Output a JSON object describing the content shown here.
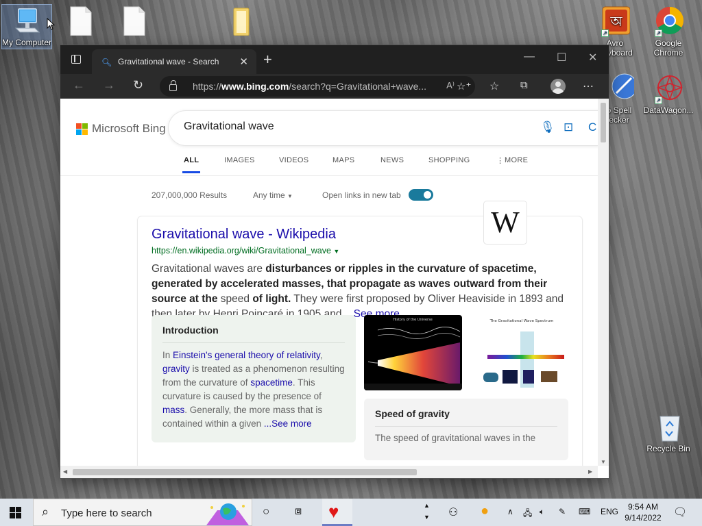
{
  "desktop": {
    "icons": [
      {
        "label": "My Computer a",
        "icon": "monitor-icon"
      },
      {
        "label": "",
        "icon": "file-icon"
      },
      {
        "label": "",
        "icon": "file-icon"
      },
      {
        "label": "",
        "icon": "folder-icon"
      },
      {
        "label": "Avro\nKeyboard",
        "icon": "avro-keyboard-icon"
      },
      {
        "label": "Google\nChrome",
        "icon": "chrome-icon"
      },
      {
        "label": "o Spell\necker",
        "icon": "spell-checker-icon"
      },
      {
        "label": "DataWagon...",
        "icon": "datawagon-icon"
      },
      {
        "label": "Recycle Bin",
        "icon": "recycle-bin-icon"
      }
    ]
  },
  "browser": {
    "tab_title": "Gravitational wave - Search",
    "address_prefix": "https://",
    "address_domain": "www.bing.com",
    "address_path": "/search?q=Gravitational+wave..."
  },
  "bing": {
    "logo_text": "Microsoft Bing",
    "query": "Gravitational wave",
    "nav": [
      "ALL",
      "IMAGES",
      "VIDEOS",
      "MAPS",
      "NEWS",
      "SHOPPING",
      "MORE"
    ],
    "results_count": "207,000,000 Results",
    "time_filter": "Any time",
    "open_links_label": "Open links in new tab",
    "open_links_enabled": true
  },
  "result": {
    "wiki_badge": "W",
    "title": "Gravitational wave - Wikipedia",
    "url": "https://en.wikipedia.org/wiki/Gravitational_wave",
    "snippet": {
      "t1": "Gravitational waves are ",
      "b1": "disturbances or ripples in the curvature of spacetime, generated by accelerated masses, that propagate as waves outward from their source at the ",
      "t2": "speed ",
      "b2": "of light.",
      "t3": " They were first proposed by Oliver Heaviside in 1893 and then later by Henri Poincaré in 1905 and ",
      "more": "...See more"
    },
    "intro": {
      "heading": "Introduction",
      "p1": "In ",
      "l1": "Einstein's general theory of relativity",
      "p2": ", ",
      "l2": "gravity",
      "p3": " is treated as a phenomenon resulting from the curvature of ",
      "l3": "spacetime",
      "p4": ". This curvature is caused by the presence of ",
      "l4": "mass",
      "p5": ". Generally, the more mass that is contained within a given ",
      "more": "...See more"
    },
    "image1_caption": "History of the Universe",
    "image2_caption": "The Gravitational Wave Spectrum",
    "speed": {
      "heading": "Speed of gravity",
      "text": "The speed of gravitational waves in the"
    }
  },
  "taskbar": {
    "search_placeholder": "Type here to search",
    "language": "ENG",
    "time": "9:54 AM",
    "date": "9/14/2022"
  }
}
